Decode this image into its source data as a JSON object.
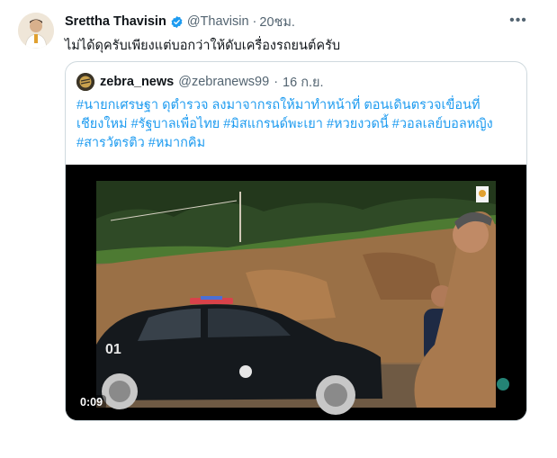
{
  "tweet": {
    "author_name": "Srettha Thavisin",
    "handle": "@Thavisin",
    "separator": "·",
    "time": "20ชม.",
    "text": "ไม่ได้ดุครับเพียงแต่บอกว่าให้ดับเครื่องรถยนต์ครับ",
    "more_glyph": "•••"
  },
  "quoted": {
    "author_name": "zebra_news",
    "handle": "@zebranews99",
    "separator": "·",
    "date": "16 ก.ย.",
    "lines": [
      "#นายกเศรษฐา ดุตำรวจ ลงมาจากรถให้มาทำหน้าที่ ตอนเดินตรวจเขื่อนที่",
      "เชียงใหม่ #รัฐบาลเพื่อไทย #มิสแกรนด์พะเยา #หวยงวดนี้ #วอลเลย์บอลหญิง",
      "#สารวัตรติว #หมากคิม"
    ],
    "video": {
      "duration": "0:09",
      "car_plate_text": "01"
    }
  },
  "colors": {
    "link": "#1d9bf0",
    "verified": "#1d9bf0",
    "secondary_text": "#536471",
    "border": "#cfd9de"
  }
}
